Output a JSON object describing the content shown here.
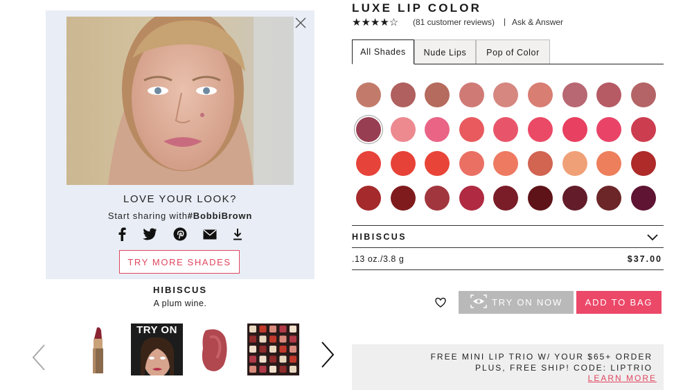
{
  "product": {
    "title": "LUXE LIP COLOR",
    "stars": "★★★★☆",
    "rating": 4,
    "reviews_text": "(81 customer reviews)",
    "separator": "|",
    "ask_answer": "Ask & Answer",
    "size": ".13 oz./3.8 g",
    "price": "$37.00"
  },
  "tryon_panel": {
    "love_title": "LOVE YOUR LOOK?",
    "share_prefix": "Start sharing with",
    "share_tag": "#BobbiBrown",
    "share_icons": [
      "facebook-icon",
      "twitter-icon",
      "pinterest-icon",
      "email-icon",
      "download-icon"
    ],
    "try_more_label": "TRY MORE SHADES"
  },
  "shade_info": {
    "name": "HIBISCUS",
    "description": "A plum wine."
  },
  "thumbnails": {
    "items": [
      {
        "name": "lipstick-bullet"
      },
      {
        "name": "try-on-model",
        "label": "TRY ON"
      },
      {
        "name": "lip-swatch-smear"
      },
      {
        "name": "lipstick-collection"
      }
    ]
  },
  "tabs": [
    {
      "label": "All Shades",
      "active": true
    },
    {
      "label": "Nude Lips",
      "active": false
    },
    {
      "label": "Pop of Color",
      "active": false
    }
  ],
  "swatches": {
    "rows": [
      [
        "#c27b6b",
        "#b0605e",
        "#b56b5d",
        "#d07a76",
        "#d58780",
        "#d87e73",
        "#b86872",
        "#b65a64",
        "#b46466"
      ],
      [
        "#983e52",
        "#ec8a90",
        "#ea6486",
        "#e85a5e",
        "#e8556a",
        "#ea4a66",
        "#e84060",
        "#e94468",
        "#cd3d50"
      ],
      [
        "#e6433a",
        "#e74238",
        "#e84538",
        "#ea7064",
        "#ee7a62",
        "#d26452",
        "#f0a077",
        "#ee7f5c",
        "#ae2b2a"
      ],
      [
        "#a52a2c",
        "#801b1d",
        "#a2363e",
        "#b02a42",
        "#7a1d28",
        "#5e1318",
        "#621c2a",
        "#6c2628",
        "#5e1432"
      ]
    ],
    "selected": [
      1,
      0
    ]
  },
  "selected_shade": {
    "label": "HIBISCUS"
  },
  "buttons": {
    "try_now": "TRY ON NOW",
    "add_to_bag": "ADD TO BAG"
  },
  "promo": {
    "line1": "FREE MINI LIP TRIO W/ YOUR $65+ ORDER",
    "line2": "PLUS, FREE SHIP! CODE: LIPTRIO",
    "link": "LEARN MORE"
  }
}
